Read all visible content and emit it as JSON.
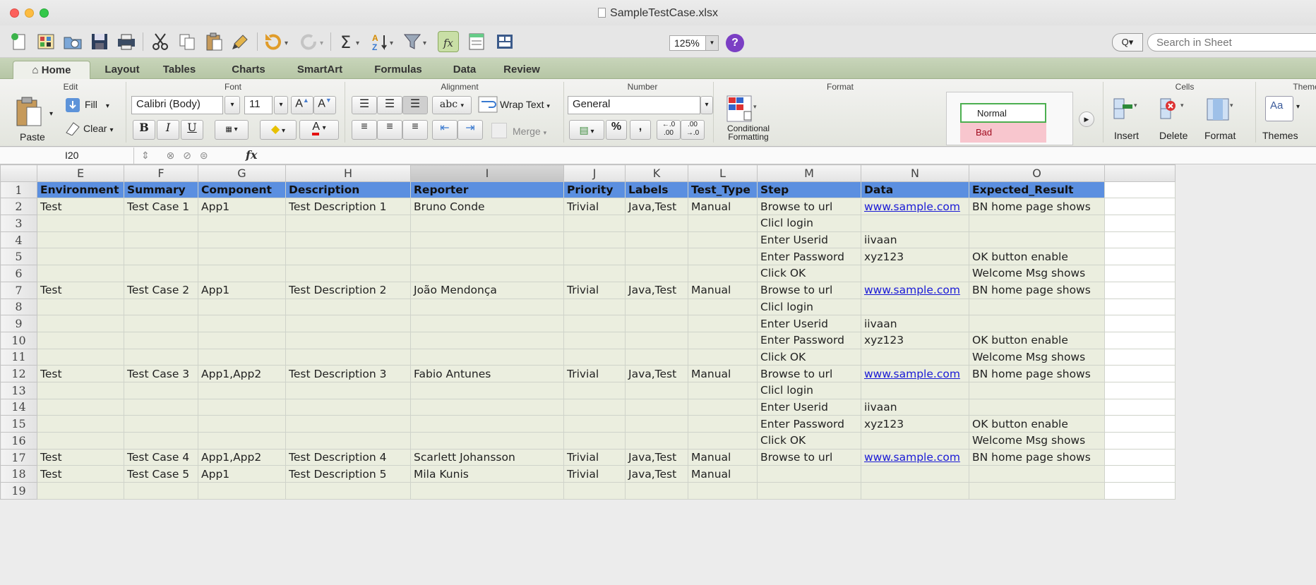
{
  "window": {
    "title": "SampleTestCase.xlsx"
  },
  "toolbar": {
    "icons": [
      "new-icon",
      "gallery-icon",
      "open-icon",
      "save-icon",
      "print-icon",
      "cut-icon",
      "copy-icon",
      "paste-icon",
      "format-painter-icon",
      "undo-icon",
      "redo-icon",
      "autosum-icon",
      "sort-icon",
      "filter-icon",
      "function-icon",
      "show-formula-icon",
      "toolbox-icon"
    ],
    "zoom": "125%",
    "search_placeholder": "Search in Sheet",
    "search_btn": "Q▾"
  },
  "ribbon_tabs": [
    "Home",
    "Layout",
    "Tables",
    "Charts",
    "SmartArt",
    "Formulas",
    "Data",
    "Review"
  ],
  "ribbon": {
    "edit": {
      "label": "Edit",
      "fill": "Fill",
      "clear": "Clear",
      "paste": "Paste"
    },
    "font": {
      "label": "Font",
      "name": "Calibri (Body)",
      "size": "11",
      "bold": "B",
      "italic": "I",
      "underline": "U",
      "grow": "A",
      "shrink": "A"
    },
    "alignment": {
      "label": "Alignment",
      "abc": "abc",
      "wrap": "Wrap Text",
      "merge": "Merge"
    },
    "number": {
      "label": "Number",
      "format": "General",
      "percent": "%",
      "comma": ","
    },
    "format": {
      "label": "Format",
      "conditional": "Conditional",
      "conditional2": "Formatting",
      "normal": "Normal",
      "bad": "Bad"
    },
    "cells": {
      "label": "Cells",
      "insert": "Insert",
      "delete": "Delete",
      "format": "Format"
    },
    "themes": {
      "label": "Theme",
      "themes": "Themes",
      "aa": "Aa"
    }
  },
  "formula_bar": {
    "cell_ref": "I20",
    "fx": "fx"
  },
  "columns": [
    "E",
    "F",
    "G",
    "H",
    "I",
    "J",
    "K",
    "L",
    "M",
    "N",
    "O"
  ],
  "rows": [
    {
      "n": "1",
      "cells": [
        "Environment",
        "Summary",
        "Component",
        "Description",
        "Reporter",
        "Priority",
        "Labels",
        "Test_Type",
        "Step",
        "Data",
        "Expected_Result"
      ]
    },
    {
      "n": "2",
      "cells": [
        "Test",
        "Test Case 1",
        "App1",
        "Test Description 1",
        "Bruno Conde",
        "Trivial",
        "Java,Test",
        "Manual",
        "Browse to url",
        "www.sample.com",
        "BN home page shows"
      ]
    },
    {
      "n": "3",
      "cells": [
        "",
        "",
        "",
        "",
        "",
        "",
        "",
        "",
        "Clicl login",
        "",
        ""
      ]
    },
    {
      "n": "4",
      "cells": [
        "",
        "",
        "",
        "",
        "",
        "",
        "",
        "",
        "Enter Userid",
        "iivaan",
        ""
      ]
    },
    {
      "n": "5",
      "cells": [
        "",
        "",
        "",
        "",
        "",
        "",
        "",
        "",
        "Enter Password",
        "xyz123",
        "OK button enable"
      ]
    },
    {
      "n": "6",
      "cells": [
        "",
        "",
        "",
        "",
        "",
        "",
        "",
        "",
        "Click OK",
        "",
        "Welcome Msg shows"
      ]
    },
    {
      "n": "7",
      "cells": [
        "Test",
        "Test Case 2",
        "App1",
        "Test Description 2",
        "João Mendonça",
        "Trivial",
        "Java,Test",
        "Manual",
        "Browse to url",
        "www.sample.com",
        "BN home page shows"
      ]
    },
    {
      "n": "8",
      "cells": [
        "",
        "",
        "",
        "",
        "",
        "",
        "",
        "",
        "Clicl login",
        "",
        ""
      ]
    },
    {
      "n": "9",
      "cells": [
        "",
        "",
        "",
        "",
        "",
        "",
        "",
        "",
        "Enter Userid",
        "iivaan",
        ""
      ]
    },
    {
      "n": "10",
      "cells": [
        "",
        "",
        "",
        "",
        "",
        "",
        "",
        "",
        "Enter Password",
        "xyz123",
        "OK button enable"
      ]
    },
    {
      "n": "11",
      "cells": [
        "",
        "",
        "",
        "",
        "",
        "",
        "",
        "",
        "Click OK",
        "",
        "Welcome Msg shows"
      ]
    },
    {
      "n": "12",
      "cells": [
        "Test",
        "Test Case 3",
        "App1,App2",
        "Test Description 3",
        "Fabio Antunes",
        "Trivial",
        "Java,Test",
        "Manual",
        "Browse to url",
        "www.sample.com",
        "BN home page shows"
      ]
    },
    {
      "n": "13",
      "cells": [
        "",
        "",
        "",
        "",
        "",
        "",
        "",
        "",
        "Clicl login",
        "",
        ""
      ]
    },
    {
      "n": "14",
      "cells": [
        "",
        "",
        "",
        "",
        "",
        "",
        "",
        "",
        "Enter Userid",
        "iivaan",
        ""
      ]
    },
    {
      "n": "15",
      "cells": [
        "",
        "",
        "",
        "",
        "",
        "",
        "",
        "",
        "Enter Password",
        "xyz123",
        "OK button enable"
      ]
    },
    {
      "n": "16",
      "cells": [
        "",
        "",
        "",
        "",
        "",
        "",
        "",
        "",
        "Click OK",
        "",
        "Welcome Msg shows"
      ]
    },
    {
      "n": "17",
      "cells": [
        "Test",
        "Test Case 4",
        "App1,App2",
        "Test Description 4",
        "Scarlett Johansson",
        "Trivial",
        "Java,Test",
        "Manual",
        "Browse to url",
        "www.sample.com",
        "BN home page shows"
      ]
    },
    {
      "n": "18",
      "cells": [
        "Test",
        "Test Case 5",
        "App1",
        "Test Description 5",
        "Mila Kunis",
        "Trivial",
        "Java,Test",
        "Manual",
        "",
        "",
        ""
      ]
    },
    {
      "n": "19",
      "cells": [
        "",
        "",
        "",
        "",
        "",
        "",
        "",
        "",
        "",
        "",
        ""
      ]
    }
  ],
  "colors": {
    "header_fill": "#5b8fe0",
    "cell_fill": "#ebeedf",
    "link": "#1a1ad6",
    "ribbon_tabs": "#b6c6a5"
  }
}
